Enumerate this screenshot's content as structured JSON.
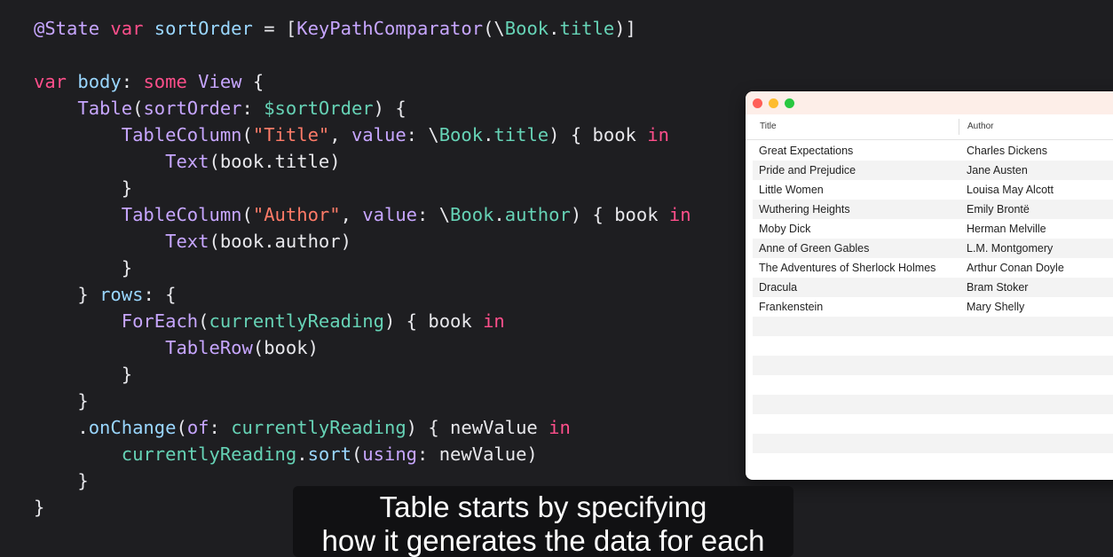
{
  "code_lines": [
    [
      {
        "c": "attr",
        "t": "@State "
      },
      {
        "c": "kw",
        "t": "var "
      },
      {
        "c": "fn",
        "t": "sortOrder"
      },
      {
        "c": "",
        "t": " = ["
      },
      {
        "c": "ty",
        "t": "KeyPathComparator"
      },
      {
        "c": "",
        "t": "(\\"
      },
      {
        "c": "prop",
        "t": "Book"
      },
      {
        "c": "",
        "t": "."
      },
      {
        "c": "prop",
        "t": "title"
      },
      {
        "c": "",
        "t": ")]"
      }
    ],
    [],
    [
      {
        "c": "kw",
        "t": "var "
      },
      {
        "c": "fn",
        "t": "body"
      },
      {
        "c": "",
        "t": ": "
      },
      {
        "c": "kw",
        "t": "some "
      },
      {
        "c": "ty",
        "t": "View"
      },
      {
        "c": "",
        "t": " {"
      }
    ],
    [
      {
        "c": "",
        "t": "    "
      },
      {
        "c": "ty",
        "t": "Table"
      },
      {
        "c": "",
        "t": "("
      },
      {
        "c": "ty",
        "t": "sortOrder"
      },
      {
        "c": "",
        "t": ": "
      },
      {
        "c": "prop",
        "t": "$sortOrder"
      },
      {
        "c": "",
        "t": ") {"
      }
    ],
    [
      {
        "c": "",
        "t": "        "
      },
      {
        "c": "ty",
        "t": "TableColumn"
      },
      {
        "c": "",
        "t": "("
      },
      {
        "c": "str",
        "t": "\"Title\""
      },
      {
        "c": "",
        "t": ", "
      },
      {
        "c": "ty",
        "t": "value"
      },
      {
        "c": "",
        "t": ": \\"
      },
      {
        "c": "prop",
        "t": "Book"
      },
      {
        "c": "",
        "t": "."
      },
      {
        "c": "prop",
        "t": "title"
      },
      {
        "c": "",
        "t": ") { book "
      },
      {
        "c": "kw",
        "t": "in"
      }
    ],
    [
      {
        "c": "",
        "t": "            "
      },
      {
        "c": "ty",
        "t": "Text"
      },
      {
        "c": "",
        "t": "(book.title)"
      }
    ],
    [
      {
        "c": "",
        "t": "        }"
      }
    ],
    [
      {
        "c": "",
        "t": "        "
      },
      {
        "c": "ty",
        "t": "TableColumn"
      },
      {
        "c": "",
        "t": "("
      },
      {
        "c": "str",
        "t": "\"Author\""
      },
      {
        "c": "",
        "t": ", "
      },
      {
        "c": "ty",
        "t": "value"
      },
      {
        "c": "",
        "t": ": \\"
      },
      {
        "c": "prop",
        "t": "Book"
      },
      {
        "c": "",
        "t": "."
      },
      {
        "c": "prop",
        "t": "author"
      },
      {
        "c": "",
        "t": ") { book "
      },
      {
        "c": "kw",
        "t": "in"
      }
    ],
    [
      {
        "c": "",
        "t": "            "
      },
      {
        "c": "ty",
        "t": "Text"
      },
      {
        "c": "",
        "t": "(book.author)"
      }
    ],
    [
      {
        "c": "",
        "t": "        }"
      }
    ],
    [
      {
        "c": "",
        "t": "    } "
      },
      {
        "c": "fn",
        "t": "rows"
      },
      {
        "c": "",
        "t": ": {"
      }
    ],
    [
      {
        "c": "",
        "t": "        "
      },
      {
        "c": "ty",
        "t": "ForEach"
      },
      {
        "c": "",
        "t": "("
      },
      {
        "c": "prop",
        "t": "currentlyReading"
      },
      {
        "c": "",
        "t": ") { book "
      },
      {
        "c": "kw",
        "t": "in"
      }
    ],
    [
      {
        "c": "",
        "t": "            "
      },
      {
        "c": "ty",
        "t": "TableRow"
      },
      {
        "c": "",
        "t": "(book)"
      }
    ],
    [
      {
        "c": "",
        "t": "        }"
      }
    ],
    [
      {
        "c": "",
        "t": "    }"
      }
    ],
    [
      {
        "c": "",
        "t": "    ."
      },
      {
        "c": "fn",
        "t": "onChange"
      },
      {
        "c": "",
        "t": "("
      },
      {
        "c": "ty",
        "t": "of"
      },
      {
        "c": "",
        "t": ": "
      },
      {
        "c": "prop",
        "t": "currentlyReading"
      },
      {
        "c": "",
        "t": ") { newValue "
      },
      {
        "c": "kw",
        "t": "in"
      }
    ],
    [
      {
        "c": "",
        "t": "        "
      },
      {
        "c": "prop",
        "t": "currentlyReading"
      },
      {
        "c": "",
        "t": "."
      },
      {
        "c": "fn",
        "t": "sort"
      },
      {
        "c": "",
        "t": "("
      },
      {
        "c": "ty",
        "t": "using"
      },
      {
        "c": "",
        "t": ": newValue)"
      }
    ],
    [
      {
        "c": "",
        "t": "    }"
      }
    ],
    [
      {
        "c": "",
        "t": "}"
      }
    ]
  ],
  "table": {
    "columns": [
      "Title",
      "Author"
    ],
    "rows": [
      {
        "title": "Great Expectations",
        "author": "Charles Dickens"
      },
      {
        "title": "Pride and Prejudice",
        "author": "Jane Austen"
      },
      {
        "title": "Little Women",
        "author": "Louisa May Alcott"
      },
      {
        "title": "Wuthering Heights",
        "author": "Emily Brontë"
      },
      {
        "title": "Moby Dick",
        "author": "Herman Melville"
      },
      {
        "title": "Anne of Green Gables",
        "author": "L.M. Montgomery"
      },
      {
        "title": "The Adventures of Sherlock Holmes",
        "author": "Arthur Conan Doyle"
      },
      {
        "title": "Dracula",
        "author": "Bram Stoker"
      },
      {
        "title": "Frankenstein",
        "author": "Mary Shelly"
      }
    ]
  },
  "caption": {
    "line1": "Table starts by specifying",
    "line2": "how it generates the data for each row."
  }
}
